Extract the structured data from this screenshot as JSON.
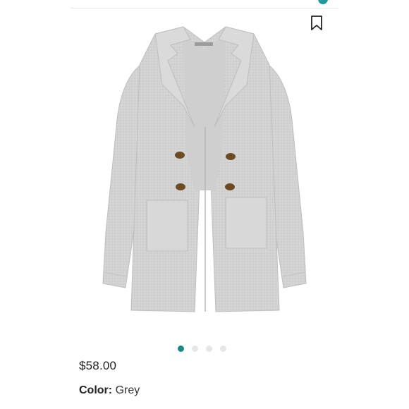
{
  "product": {
    "price": "$58.00",
    "color_label": "Color:",
    "color_value": "Grey",
    "image_icon": "grey-long-cardigan-coat"
  },
  "carousel": {
    "count": 4,
    "active_index": 0,
    "active_color": "#1a8a86",
    "inactive_color": "#e6e6e6"
  },
  "actions": {
    "bookmark_icon": "bookmark-icon"
  },
  "colors": {
    "accent": "#1f9a9a",
    "coat": "#d4d4d4",
    "buttons": "#6b4a24"
  }
}
